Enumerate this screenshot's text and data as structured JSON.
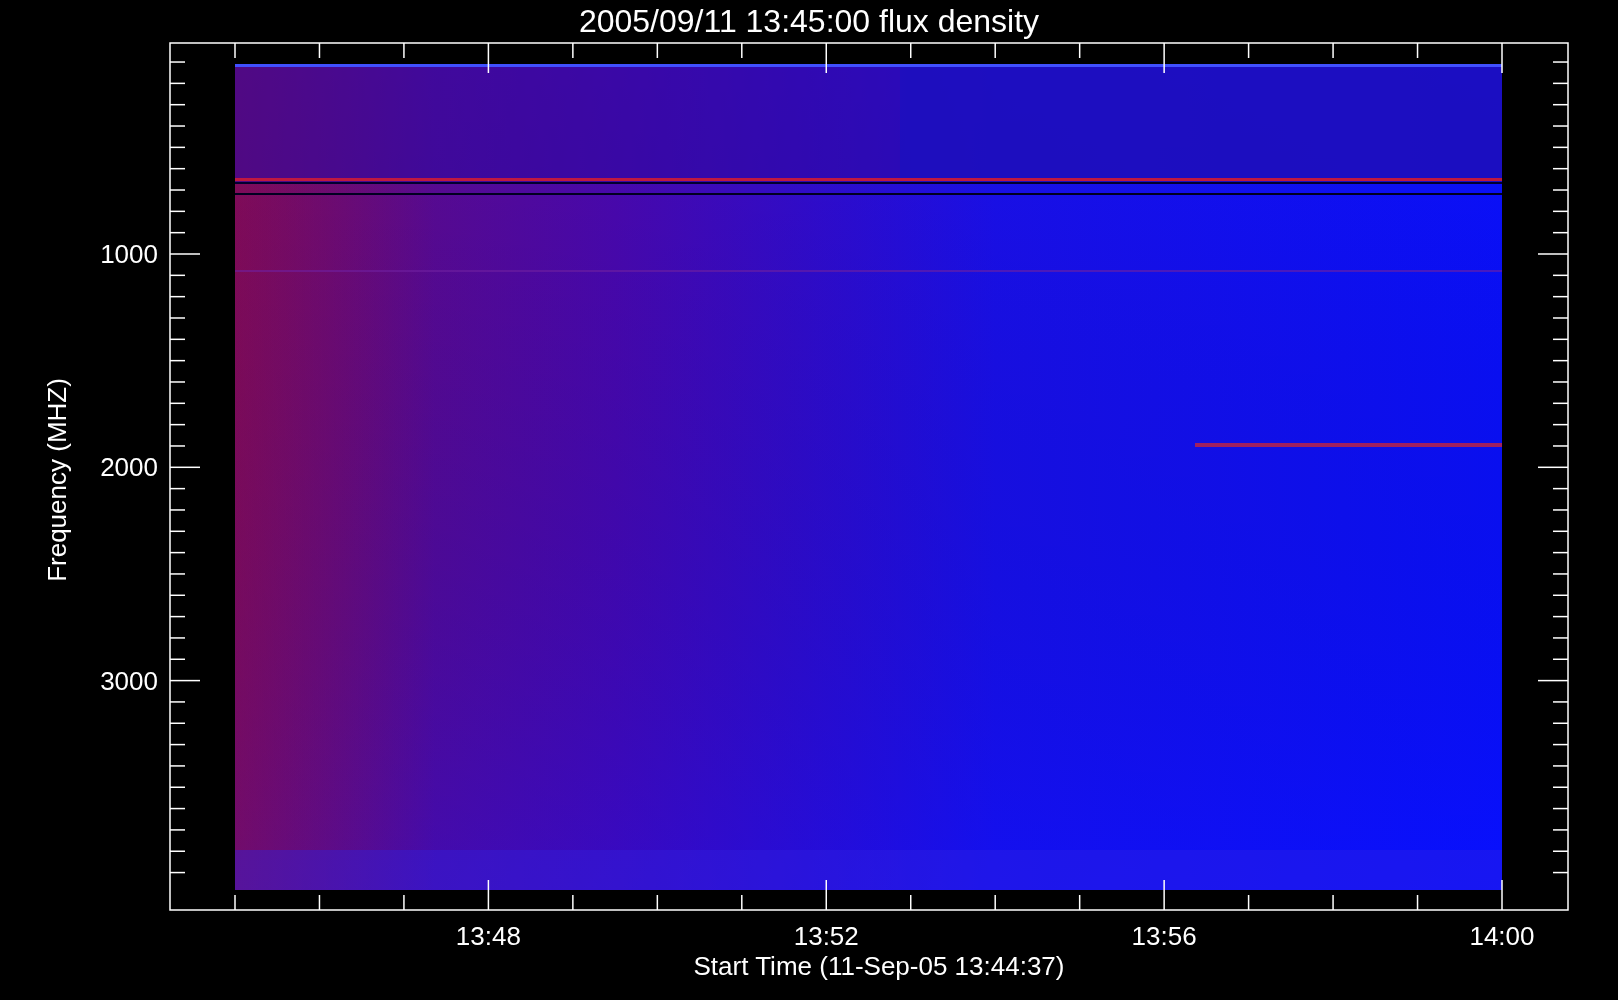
{
  "plot": {
    "title": "2005/09/11 13:45:00 flux density",
    "xlabel": "Start Time (11-Sep-05 13:44:37)",
    "ylabel": "Frequency (MHZ)",
    "xticks": [
      "13:48",
      "13:52",
      "13:56",
      "14:00"
    ],
    "yticks": [
      "1000",
      "2000",
      "3000"
    ]
  }
}
